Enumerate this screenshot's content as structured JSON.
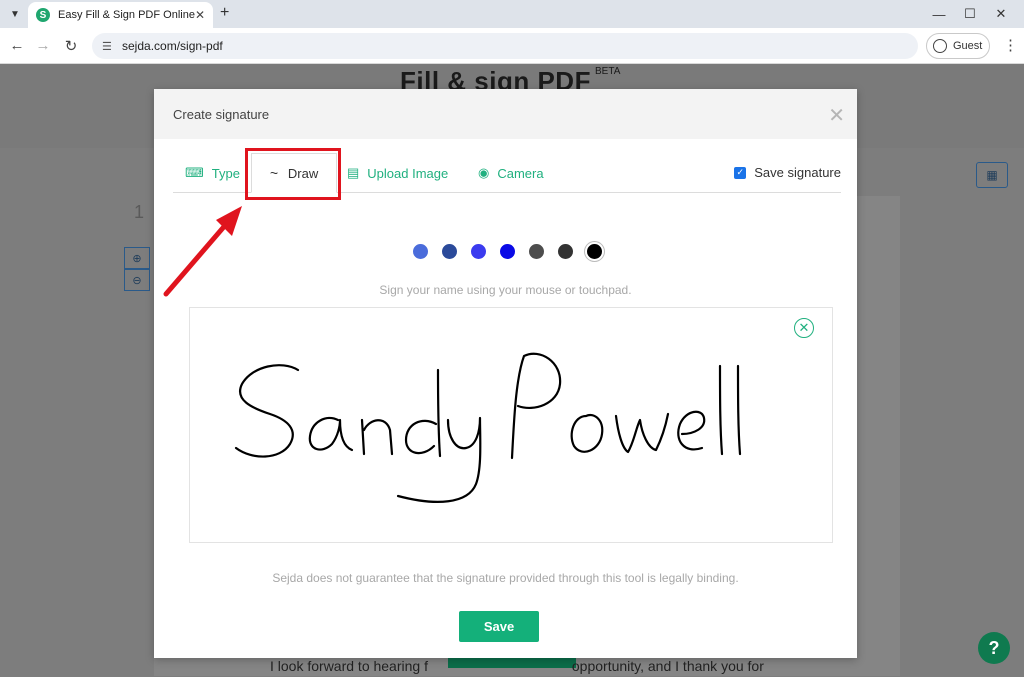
{
  "browser": {
    "tab_title": "Easy Fill & Sign PDF Online",
    "favicon_letter": "S",
    "url": "sejda.com/sign-pdf",
    "profile_label": "Guest"
  },
  "page": {
    "title": "Fill & sign PDF",
    "beta": "BETA",
    "page_number": "1",
    "bottom_text": "I look forward to hearing f                                     opportunity, and I thank you for"
  },
  "modal": {
    "title": "Create signature",
    "tabs": {
      "type": "Type",
      "draw": "Draw",
      "upload": "Upload Image",
      "camera": "Camera"
    },
    "save_signature_label": "Save signature",
    "save_signature_checked": true,
    "colors": [
      "#4a6cdb",
      "#2b4a9a",
      "#3b3bef",
      "#0a0ae6",
      "#4d4d4d",
      "#333333",
      "#000000"
    ],
    "selected_color": "#000000",
    "hint": "Sign your name using your mouse or touchpad.",
    "disclaimer": "Sejda does not guarantee that the signature provided through this tool is legally binding.",
    "save_button": "Save",
    "signature_name": "Sandy Powell"
  },
  "colors": {
    "accent_green": "#20b07f",
    "highlight_red": "#e0141e"
  }
}
